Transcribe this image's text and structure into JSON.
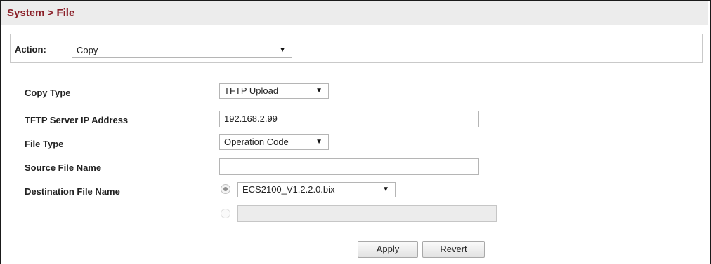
{
  "header": {
    "title": "System > File"
  },
  "action": {
    "label": "Action:",
    "selected": "Copy"
  },
  "form": {
    "copy_type": {
      "label": "Copy Type",
      "selected": "TFTP Upload"
    },
    "tftp_server": {
      "label": "TFTP Server IP Address",
      "value": "192.168.2.99"
    },
    "file_type": {
      "label": "File Type",
      "selected": "Operation Code"
    },
    "source_file": {
      "label": "Source File Name",
      "value": ""
    },
    "destination_file": {
      "label": "Destination File Name",
      "selected_option": "ECS2100_V1.2.2.0.bix",
      "custom_value": "",
      "selected_radio": "existing"
    }
  },
  "buttons": {
    "apply": "Apply",
    "revert": "Revert"
  },
  "icons": {
    "caret": "▼"
  }
}
